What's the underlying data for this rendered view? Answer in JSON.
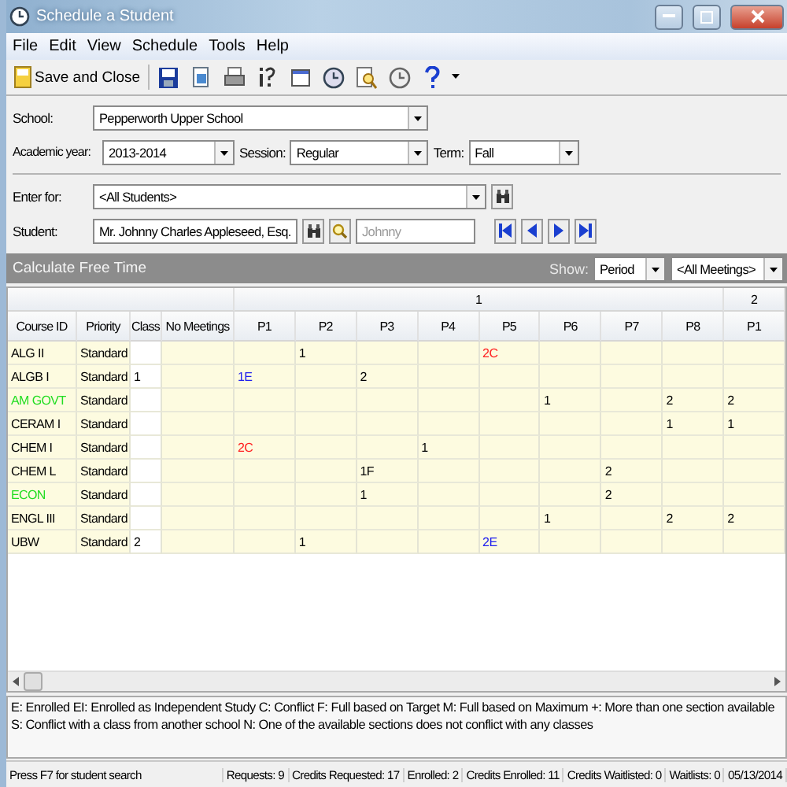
{
  "window": {
    "title": "Schedule a Student"
  },
  "menu": [
    "File",
    "Edit",
    "View",
    "Schedule",
    "Tools",
    "Help"
  ],
  "toolbar": {
    "save_label": "Save and Close"
  },
  "form": {
    "school": {
      "label": "School:",
      "value": "Pepperworth Upper School"
    },
    "academic_year": {
      "label": "Academic year:",
      "value": "2013-2014"
    },
    "session": {
      "label": "Session:",
      "value": "Regular"
    },
    "term": {
      "label": "Term:",
      "value": "Fall"
    },
    "enter_for": {
      "label": "Enter for:",
      "value": "<All Students>"
    },
    "student": {
      "label": "Student:",
      "value": "Mr. Johnny Charles Appleseed, Esq.",
      "nickname": "Johnny"
    }
  },
  "free_time_bar": {
    "title": "Calculate Free Time",
    "show_label": "Show:",
    "show_value": "Period",
    "meetings_value": "<All Meetings>"
  },
  "grid": {
    "group_headers": [
      "1",
      "2"
    ],
    "columns": [
      "Course ID",
      "Priority",
      "Class",
      "No Meetings",
      "P1",
      "P2",
      "P3",
      "P4",
      "P5",
      "P6",
      "P7",
      "P8",
      "P1"
    ],
    "rows": [
      {
        "course": "ALG II",
        "color": "#000000",
        "priority": "Standard",
        "cells": [
          null,
          "1",
          null,
          null,
          {
            "text": "2C",
            "color": "#ff2020"
          },
          null,
          null,
          null,
          null
        ]
      },
      {
        "course": "ALGB I",
        "color": "#000000",
        "priority": "Standard",
        "class": "1",
        "cells": [
          {
            "text": "1E",
            "color": "#2020ee"
          },
          null,
          "2",
          null,
          null,
          null,
          null,
          null,
          null
        ]
      },
      {
        "course": "AM GOVT",
        "color": "#22dd22",
        "priority": "Standard",
        "cells": [
          null,
          null,
          null,
          null,
          null,
          "1",
          null,
          "2",
          "2"
        ]
      },
      {
        "course": "CERAM I",
        "color": "#000000",
        "priority": "Standard",
        "cells": [
          null,
          null,
          null,
          null,
          null,
          null,
          null,
          "1",
          "1"
        ]
      },
      {
        "course": "CHEM I",
        "color": "#000000",
        "priority": "Standard",
        "cells": [
          {
            "text": "2C",
            "color": "#ff2020"
          },
          null,
          null,
          "1",
          null,
          null,
          null,
          null,
          null
        ]
      },
      {
        "course": "CHEM L",
        "color": "#000000",
        "priority": "Standard",
        "cells": [
          null,
          null,
          "1F",
          null,
          null,
          null,
          "2",
          null,
          null
        ]
      },
      {
        "course": "ECON",
        "color": "#22dd22",
        "priority": "Standard",
        "cells": [
          null,
          null,
          "1",
          null,
          null,
          null,
          "2",
          null,
          null
        ]
      },
      {
        "course": "ENGL III",
        "color": "#000000",
        "priority": "Standard",
        "cells": [
          null,
          null,
          null,
          null,
          null,
          "1",
          null,
          "2",
          "2"
        ]
      },
      {
        "course": "UBW",
        "color": "#000000",
        "priority": "Standard",
        "class": "2",
        "cells": [
          null,
          "1",
          null,
          null,
          {
            "text": "2E",
            "color": "#2020ee"
          },
          null,
          null,
          null,
          null
        ]
      }
    ]
  },
  "legend": "E: Enrolled EI: Enrolled as Independent Study C: Conflict  F: Full based on Target  M: Full based on Maximum  +: More than one section available  S: Conflict with a class from another school  N: One of the available sections does not conflict with any classes",
  "status_bar": [
    "Press F7 for student search",
    "Requests: 9",
    "Credits Requested: 17",
    "Enrolled: 2",
    "Credits Enrolled: 11",
    "Credits Waitlisted: 0",
    "Waitlists: 0",
    "05/13/2014"
  ]
}
